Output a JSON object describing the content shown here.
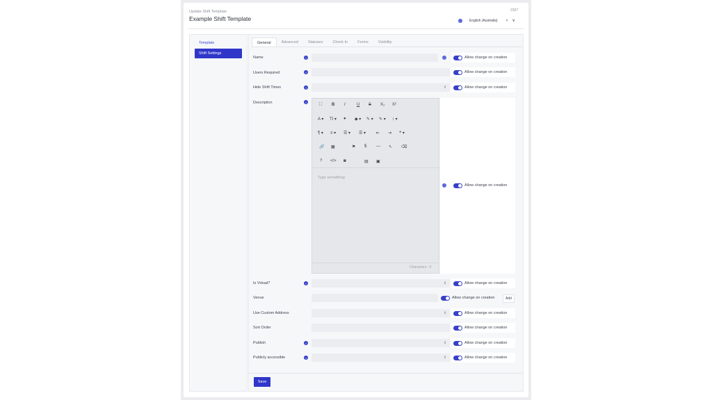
{
  "header": {
    "breadcrumb": "Update Shift Template",
    "title": "Example Shift Template",
    "code": "2307",
    "language": "English (Australia)",
    "language_clear": "×",
    "language_chevron": "∨"
  },
  "sidebar": {
    "items": [
      {
        "label": "Template"
      },
      {
        "label": "Shift Settings"
      }
    ]
  },
  "tabs": [
    "General",
    "Advanced",
    "Statuses",
    "Check In",
    "Forms",
    "Visibility"
  ],
  "fields": {
    "name": "Name",
    "users_required": "Users Required",
    "hide_shift_times": "Hide Shift Times",
    "description": "Description",
    "is_virtual": "Is Virtual?",
    "venue": "Venue",
    "use_custom_address": "Use Custom Address",
    "sort_order": "Sort Order",
    "publish": "Publish",
    "publicly_accessible": "Publicly accessible"
  },
  "allow_label": "Allow change on creation",
  "select_arrow": "⇕",
  "add_label": "Add",
  "editor": {
    "placeholder": "Type something",
    "characters": "Characters : 0",
    "row1": [
      "⛶",
      "B",
      "I",
      "U",
      "S",
      "X₂",
      "X²"
    ],
    "row2": [
      "A ▾",
      "TI ▾",
      "●",
      "◆ ▾",
      "✎ ▾",
      "✎ ▾",
      "↕ ▾"
    ],
    "row3": [
      "¶ ▾",
      "≡ ▾",
      "☰ ▾",
      "☰ ▾",
      "⇤",
      "⇥",
      "❝ ▾"
    ],
    "row4": [
      "🔗",
      "▦",
      "⚑",
      "$",
      "—",
      "↖",
      "⌫"
    ],
    "row5": [
      "?",
      "</>",
      "◙",
      "▤",
      "▣"
    ]
  },
  "save_label": "Save"
}
